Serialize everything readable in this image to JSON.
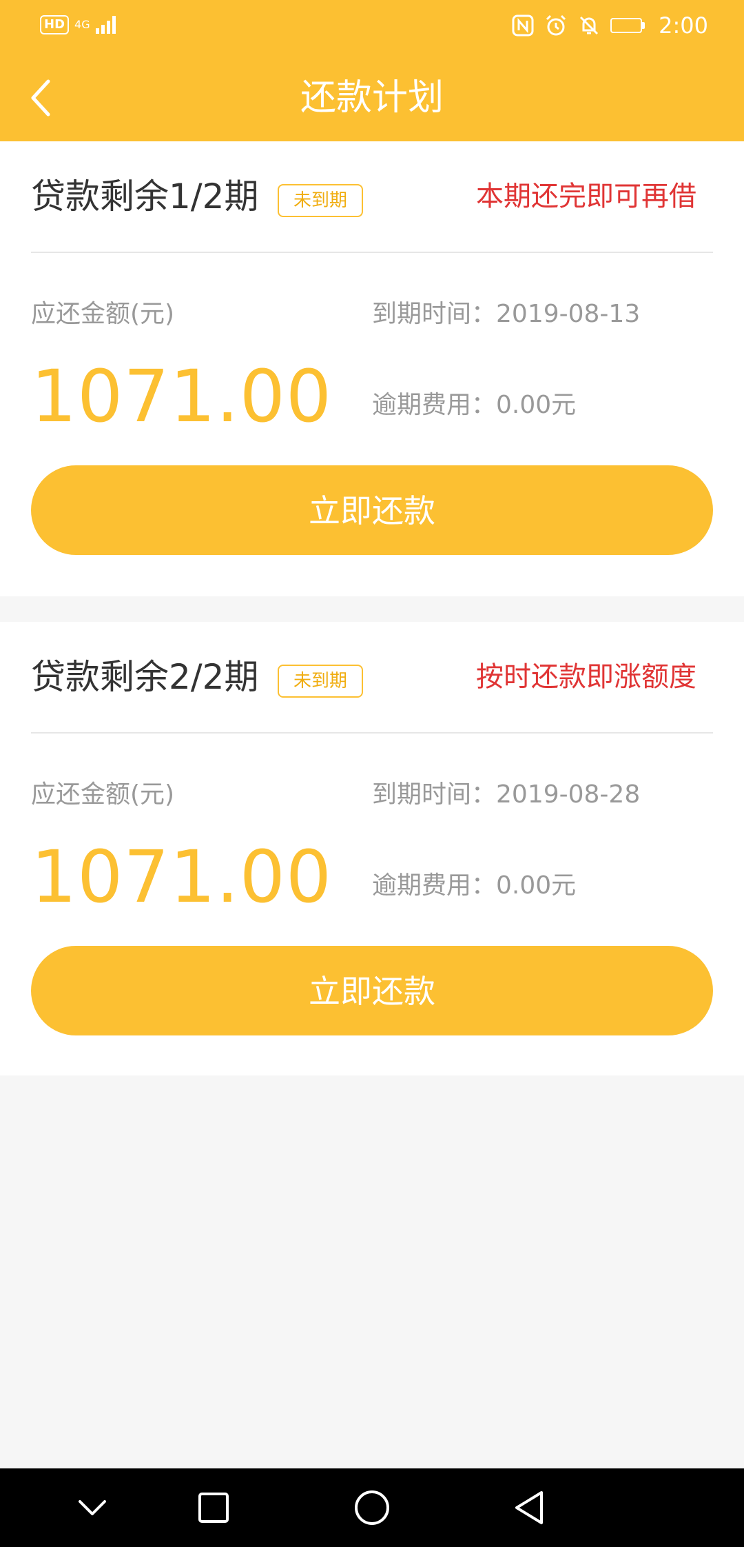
{
  "status_bar": {
    "hd_label": "HD",
    "network_label": "4G",
    "time": "2:00",
    "icons": [
      "nfc-icon",
      "alarm-icon",
      "mute-bell-icon",
      "battery-icon"
    ]
  },
  "header": {
    "title": "还款计划",
    "back_icon": "chevron-left-icon"
  },
  "plans": [
    {
      "period_title": "贷款剩余1/2期",
      "status": "未到期",
      "promo": "本期还完即可再借",
      "amount_label": "应还金额(元)",
      "amount": "1071.00",
      "due_label": "到期时间：",
      "due_date": "2019-08-13",
      "fee_label": "逾期费用：",
      "fee": "0.00元",
      "button_label": "立即还款"
    },
    {
      "period_title": "贷款剩余2/2期",
      "status": "未到期",
      "promo": "按时还款即涨额度",
      "amount_label": "应还金额(元)",
      "amount": "1071.00",
      "due_label": "到期时间：",
      "due_date": "2019-08-28",
      "fee_label": "逾期费用：",
      "fee": "0.00元",
      "button_label": "立即还款"
    }
  ],
  "colors": {
    "accent": "#fcc032",
    "promo_red": "#e03535",
    "label_gray": "#999999",
    "title_dark": "#333333",
    "page_bg": "#f6f6f6"
  },
  "nav_bar": {
    "icons": [
      "chevron-down-icon",
      "square-icon",
      "circle-icon",
      "triangle-back-icon"
    ]
  }
}
